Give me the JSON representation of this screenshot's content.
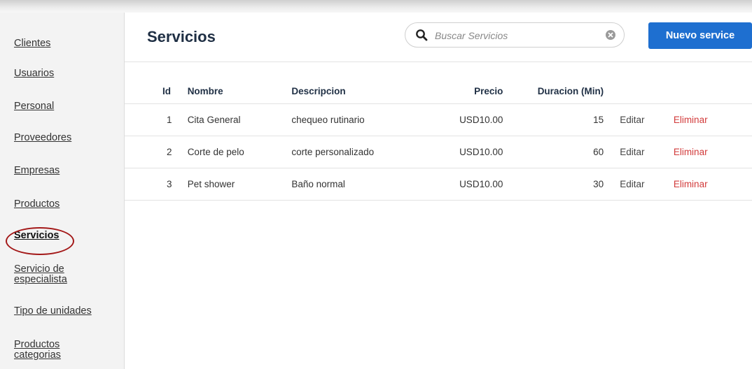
{
  "sidebar": {
    "items": [
      {
        "label": "Clientes"
      },
      {
        "label": "Usuarios"
      },
      {
        "label": "Personal"
      },
      {
        "label": "Proveedores"
      },
      {
        "label": "Empresas"
      },
      {
        "label": "Productos"
      },
      {
        "label": "Servicios",
        "active": true
      },
      {
        "label": "Servicio de especialista"
      },
      {
        "label": "Tipo de unidades"
      },
      {
        "label": "Productos categorias"
      }
    ]
  },
  "header": {
    "title": "Servicios",
    "search_placeholder": "Buscar Servicios",
    "search_value": "",
    "new_button_label": "Nuevo service"
  },
  "table": {
    "columns": [
      "Id",
      "Nombre",
      "Descripcion",
      "Precio",
      "Duracion (Min)"
    ],
    "rows": [
      {
        "id": "1",
        "nombre": "Cita General",
        "descripcion": "chequeo rutinario",
        "precio": "USD10.00",
        "duracion": "15",
        "edit": "Editar",
        "delete": "Eliminar"
      },
      {
        "id": "2",
        "nombre": "Corte de pelo",
        "descripcion": "corte personalizado",
        "precio": "USD10.00",
        "duracion": "60",
        "edit": "Editar",
        "delete": "Eliminar"
      },
      {
        "id": "3",
        "nombre": "Pet shower",
        "descripcion": "Baño normal",
        "precio": "USD10.00",
        "duracion": "30",
        "edit": "Editar",
        "delete": "Eliminar"
      }
    ]
  },
  "colors": {
    "primary": "#1e6fd0",
    "danger": "#d23b3b",
    "annotation_circle": "#a31818"
  },
  "icons": {
    "search": "search-icon",
    "clear": "clear-icon"
  }
}
